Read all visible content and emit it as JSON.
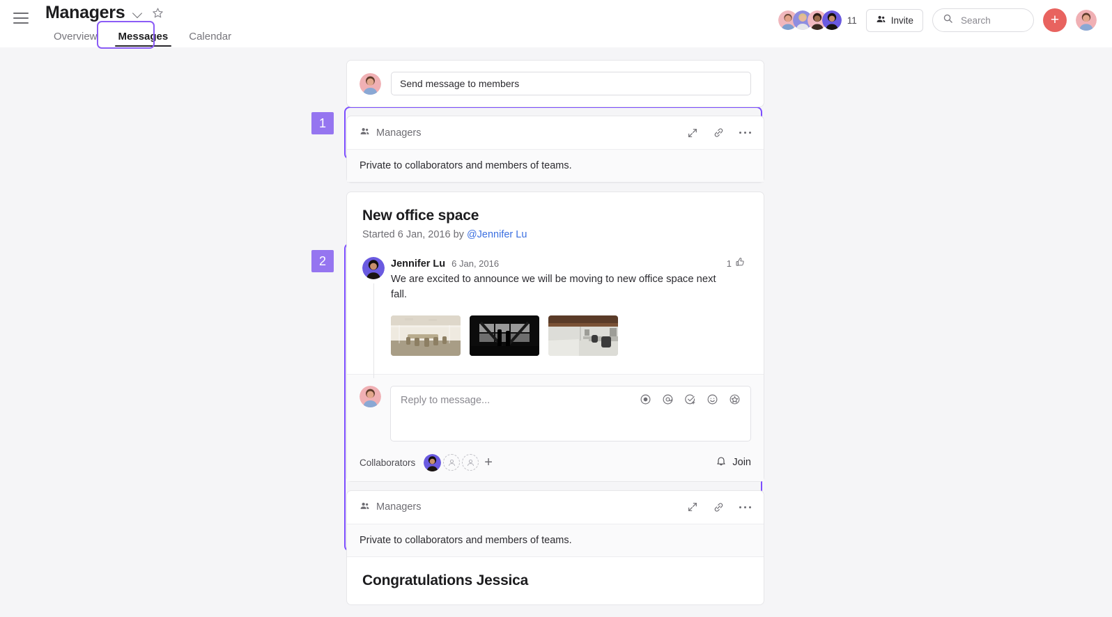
{
  "header": {
    "menu_icon": "hamburger-icon",
    "project_title": "Managers",
    "dropdown_icon": "chevron-down-icon",
    "favorite_icon": "star-icon",
    "tabs": [
      {
        "label": "Overview",
        "active": false
      },
      {
        "label": "Messages",
        "active": true
      },
      {
        "label": "Calendar",
        "active": false
      }
    ],
    "member_count": "11",
    "invite_label": "Invite",
    "invite_icon": "people-icon",
    "search_placeholder": "Search",
    "search_value": "",
    "search_icon": "search-icon",
    "add_icon": "plus-icon",
    "profile_icon": "avatar"
  },
  "steps": [
    {
      "number": "1"
    },
    {
      "number": "2"
    }
  ],
  "compose": {
    "placeholder": "Send message to members",
    "value": "Send message to members"
  },
  "cards": [
    {
      "team_label": "Managers",
      "team_icon": "people-icon",
      "expand_icon": "expand-icon",
      "link_icon": "link-icon",
      "more_icon": "ellipsis-icon",
      "privacy_note": "Private to collaborators and members of teams."
    },
    {
      "team_label": "Managers",
      "team_icon": "people-icon",
      "expand_icon": "expand-icon",
      "link_icon": "link-icon",
      "more_icon": "ellipsis-icon",
      "privacy_note": "Private to collaborators and members of teams."
    }
  ],
  "thread": {
    "title": "New office space",
    "meta_prefix": "Started 6 Jan, 2016 by ",
    "author_mention": "@Jennifer Lu",
    "message": {
      "author": "Jennifer Lu",
      "date": "6 Jan, 2016",
      "text": "We are excited to announce we will be moving to new office space next fall.",
      "like_count": "1",
      "like_icon": "thumbs-up-icon",
      "attachments": [
        {
          "name": "conference-room-photo"
        },
        {
          "name": "dark-window-view-photo"
        },
        {
          "name": "open-office-desks-photo"
        }
      ]
    },
    "reply": {
      "placeholder": "Reply to message...",
      "value": "",
      "icons": [
        "record-icon",
        "mention-icon",
        "task-icon",
        "emoji-icon",
        "sticker-icon"
      ]
    },
    "collaborators": {
      "label": "Collaborators",
      "add_icon": "plus-icon",
      "empty_slots": 2
    },
    "join": {
      "label": "Join",
      "icon": "bell-icon"
    }
  },
  "thread_bottom": {
    "title": "Congratulations Jessica"
  },
  "colors": {
    "accent_purple": "#7c4dff",
    "step_badge": "#9575f0",
    "add_button_red": "#e8635f",
    "mention_blue": "#3b6fe0",
    "page_bg": "#f5f5f7"
  }
}
